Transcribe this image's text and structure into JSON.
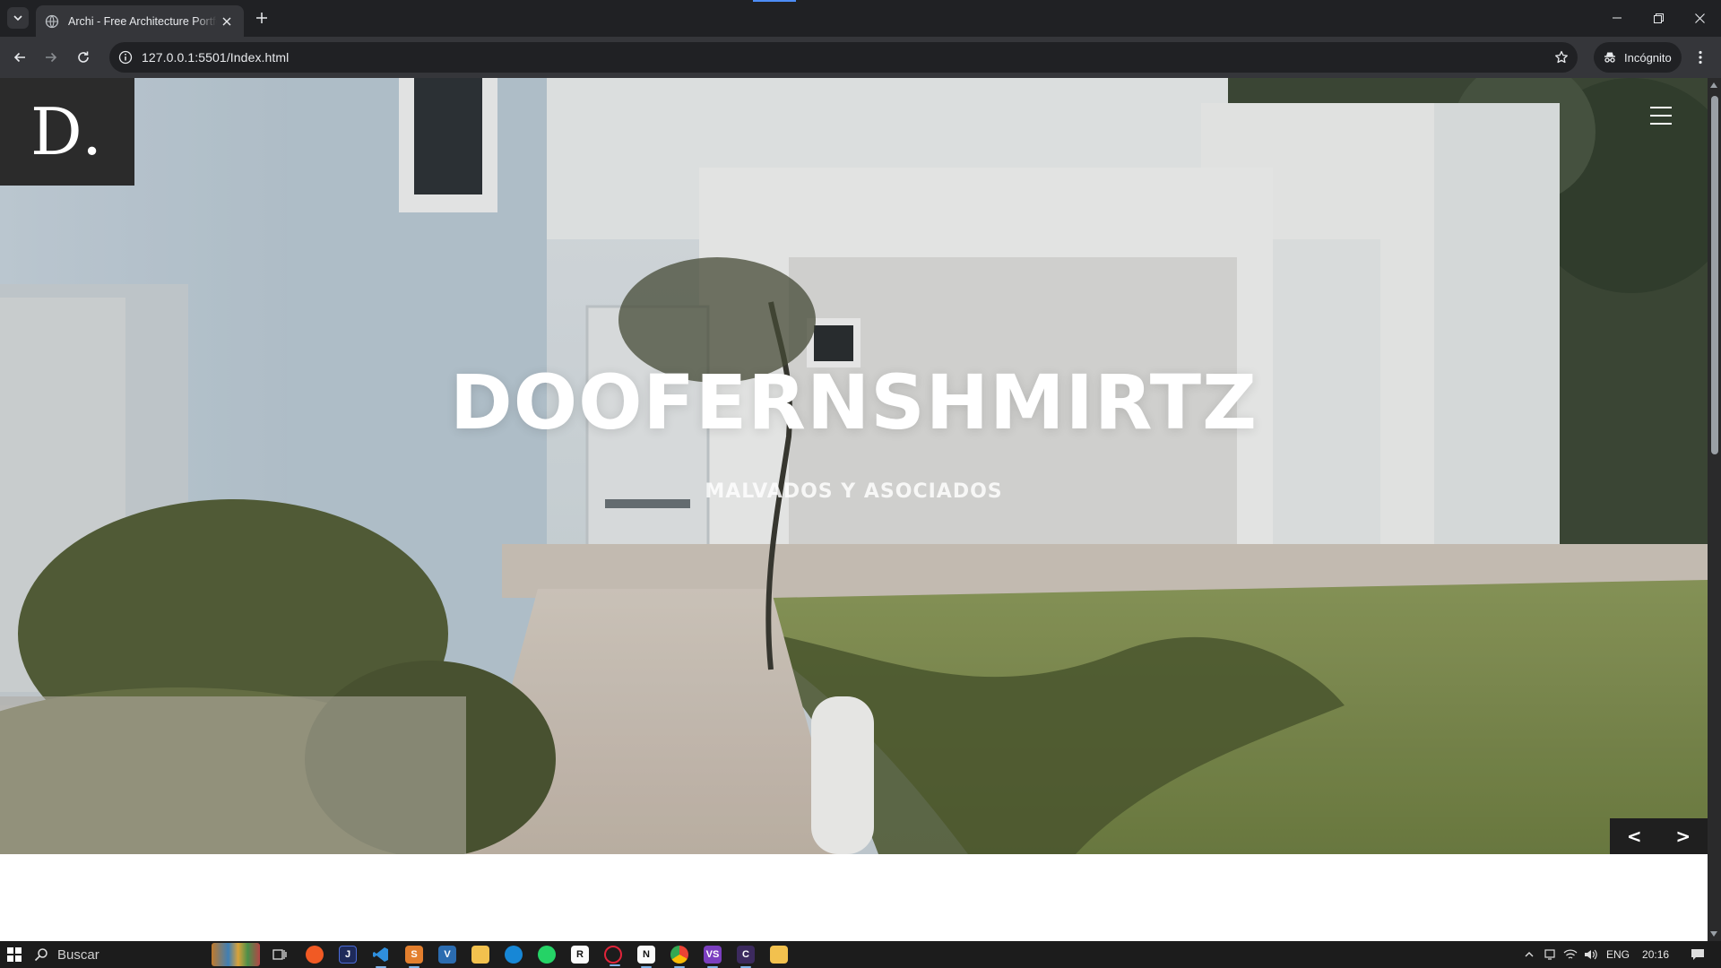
{
  "browser": {
    "tab_title": "Archi - Free Architecture Portfolio",
    "url": "127.0.0.1:5501/Index.html",
    "incognito_label": "Incógnito"
  },
  "page": {
    "logo": "D.",
    "hero_title": "DOOFERNSHMIRTZ",
    "hero_subtitle": "MALVADOS Y ASOCIADOS",
    "prev_label": "<",
    "next_label": ">"
  },
  "taskbar": {
    "search_label": "Buscar",
    "language": "ENG",
    "time": "20:16"
  },
  "colors": {
    "browser_dark": "#202124",
    "browser_toolbar": "#35363a",
    "logo_box": "#2b2b2b",
    "slider_nav": "#1f1f1f",
    "accent_blue": "#4d8df6"
  }
}
